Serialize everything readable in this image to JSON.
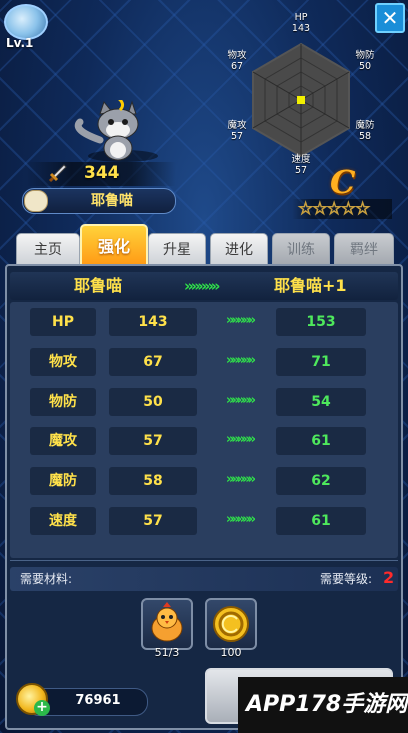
{
  "player": {
    "level": "Lv.1"
  },
  "character": {
    "power": "344",
    "name": "耶鲁喵",
    "rank": "C",
    "stars": "☆☆☆☆☆"
  },
  "radar": {
    "hp": {
      "name": "HP",
      "value": "143"
    },
    "patk": {
      "name": "物攻",
      "value": "67"
    },
    "pdef": {
      "name": "物防",
      "value": "50"
    },
    "matk": {
      "name": "魔攻",
      "value": "57"
    },
    "mdef": {
      "name": "魔防",
      "value": "58"
    },
    "spd": {
      "name": "速度",
      "value": "57"
    }
  },
  "tabs": [
    {
      "label": "主页"
    },
    {
      "label": "强化"
    },
    {
      "label": "升星"
    },
    {
      "label": "进化"
    },
    {
      "label": "训练"
    },
    {
      "label": "羁绊"
    }
  ],
  "enhance": {
    "from_name": "耶鲁喵",
    "to_name": "耶鲁喵+1",
    "arrows": "»»»»»",
    "rows": [
      {
        "label": "HP",
        "current": "143",
        "next": "153"
      },
      {
        "label": "物攻",
        "current": "67",
        "next": "71"
      },
      {
        "label": "物防",
        "current": "50",
        "next": "54"
      },
      {
        "label": "魔攻",
        "current": "57",
        "next": "61"
      },
      {
        "label": "魔防",
        "current": "58",
        "next": "62"
      },
      {
        "label": "速度",
        "current": "57",
        "next": "61"
      }
    ]
  },
  "materials": {
    "label": "需要材料:",
    "level_label": "需要等级:",
    "level_value": "2",
    "items": [
      {
        "icon": "chick-icon",
        "count": "51/3"
      },
      {
        "icon": "gold-coin-icon",
        "count": "100"
      }
    ]
  },
  "currency": {
    "gold": "76961"
  },
  "watermark": {
    "text": "APP178手游网"
  },
  "colors": {
    "accent": "#ffe14a",
    "green": "#4ee85c",
    "tab_active": "#ffb020",
    "required": "#ff2a2a"
  }
}
